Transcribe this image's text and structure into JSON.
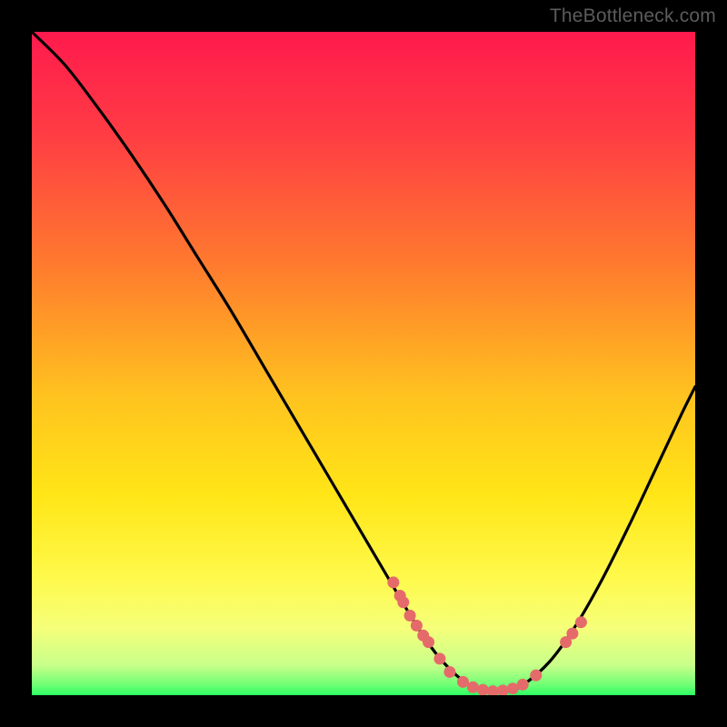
{
  "attribution": "TheBottleneck.com",
  "gradient": {
    "stops": [
      {
        "offset": 0.0,
        "color": "#ff1a4d"
      },
      {
        "offset": 0.15,
        "color": "#ff3b44"
      },
      {
        "offset": 0.35,
        "color": "#ff7a2e"
      },
      {
        "offset": 0.55,
        "color": "#ffc31f"
      },
      {
        "offset": 0.7,
        "color": "#ffe617"
      },
      {
        "offset": 0.82,
        "color": "#fff94a"
      },
      {
        "offset": 0.9,
        "color": "#f5ff7a"
      },
      {
        "offset": 0.955,
        "color": "#c8ff8a"
      },
      {
        "offset": 0.985,
        "color": "#6dff74"
      },
      {
        "offset": 1.0,
        "color": "#2cff62"
      }
    ]
  },
  "chart_data": {
    "type": "line",
    "title": "",
    "xlabel": "",
    "ylabel": "",
    "xlim": [
      0,
      100
    ],
    "ylim": [
      0,
      100
    ],
    "series": [
      {
        "name": "curve",
        "x": [
          0,
          5,
          10,
          15,
          20,
          25,
          30,
          35,
          40,
          45,
          50,
          55,
          58,
          60,
          62,
          64,
          66,
          68,
          70,
          72,
          74,
          78,
          82,
          86,
          90,
          94,
          98,
          100
        ],
        "y": [
          100,
          95,
          88.5,
          81.5,
          74,
          66,
          58,
          49.5,
          41,
          32.5,
          24,
          15.5,
          10.5,
          7.5,
          5.0,
          3.0,
          1.5,
          0.7,
          0.5,
          0.7,
          1.5,
          5.0,
          10.5,
          17.5,
          25.5,
          34.0,
          42.5,
          46.5
        ]
      }
    ],
    "markers": {
      "name": "dots",
      "color": "#e56a6a",
      "x": [
        54.5,
        55.5,
        56.0,
        57.0,
        58.0,
        59.0,
        59.8,
        61.5,
        63.0,
        65.0,
        66.5,
        68.0,
        69.5,
        71.0,
        72.5,
        74.0,
        76.0,
        80.5,
        81.5,
        82.8
      ],
      "y": [
        17.0,
        15.0,
        14.0,
        12.0,
        10.5,
        9.0,
        8.0,
        5.5,
        3.5,
        2.0,
        1.2,
        0.8,
        0.6,
        0.7,
        1.0,
        1.6,
        3.0,
        8.0,
        9.3,
        11.0
      ]
    }
  }
}
